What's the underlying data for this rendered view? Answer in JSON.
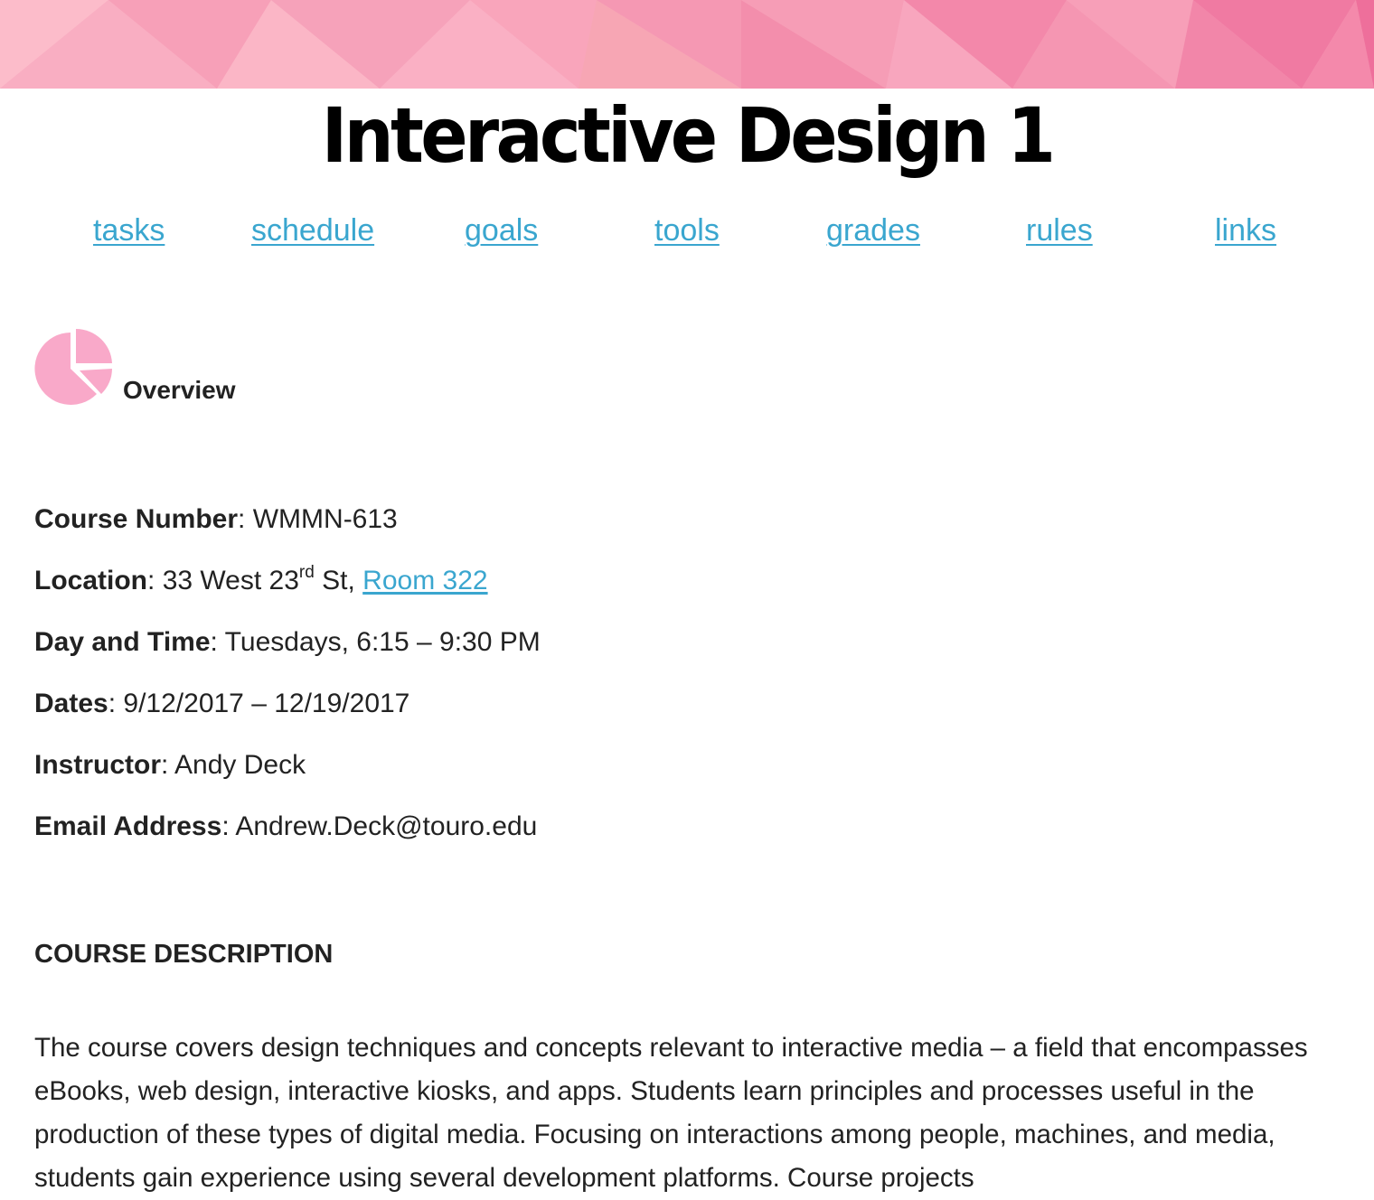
{
  "header": {
    "banner_colors": [
      "#fcbccc",
      "#f8a7bf",
      "#f48fb0",
      "#f27ba4",
      "#fab3c4"
    ],
    "title": "Interactive Design 1"
  },
  "nav": {
    "items": [
      {
        "label": "tasks"
      },
      {
        "label": "schedule"
      },
      {
        "label": "goals"
      },
      {
        "label": "tools"
      },
      {
        "label": "grades"
      },
      {
        "label": "rules"
      },
      {
        "label": "links"
      }
    ],
    "link_color": "#3aa6cf"
  },
  "overview": {
    "icon": "pie-chart-icon",
    "icon_color": "#f9a9c9",
    "label": "Overview"
  },
  "course_info": {
    "number_label": "Course Number",
    "number_value": "WMMN-613",
    "location_label": "Location",
    "location_prefix": "33 West 23",
    "location_sup": "rd",
    "location_suffix": "St,",
    "location_link": "Room 322",
    "daytime_label": "Day and Time",
    "daytime_value": "Tuesdays, 6:15 – 9:30 PM",
    "dates_label": "Dates",
    "dates_value": "9/12/2017 – 12/19/2017",
    "instructor_label": "Instructor",
    "instructor_value": "Andy Deck",
    "email_label": "Email Address",
    "email_value": "Andrew.Deck@touro.edu",
    "separator": ":"
  },
  "description": {
    "heading": "COURSE DESCRIPTION",
    "body": "The course covers design techniques and concepts relevant to interactive media – a field that encompasses eBooks, web design, interactive kiosks, and apps. Students learn principles and processes useful in the production of these types of digital media. Focusing on interactions among people, machines, and media, students gain experience using several development platforms. Course projects"
  }
}
